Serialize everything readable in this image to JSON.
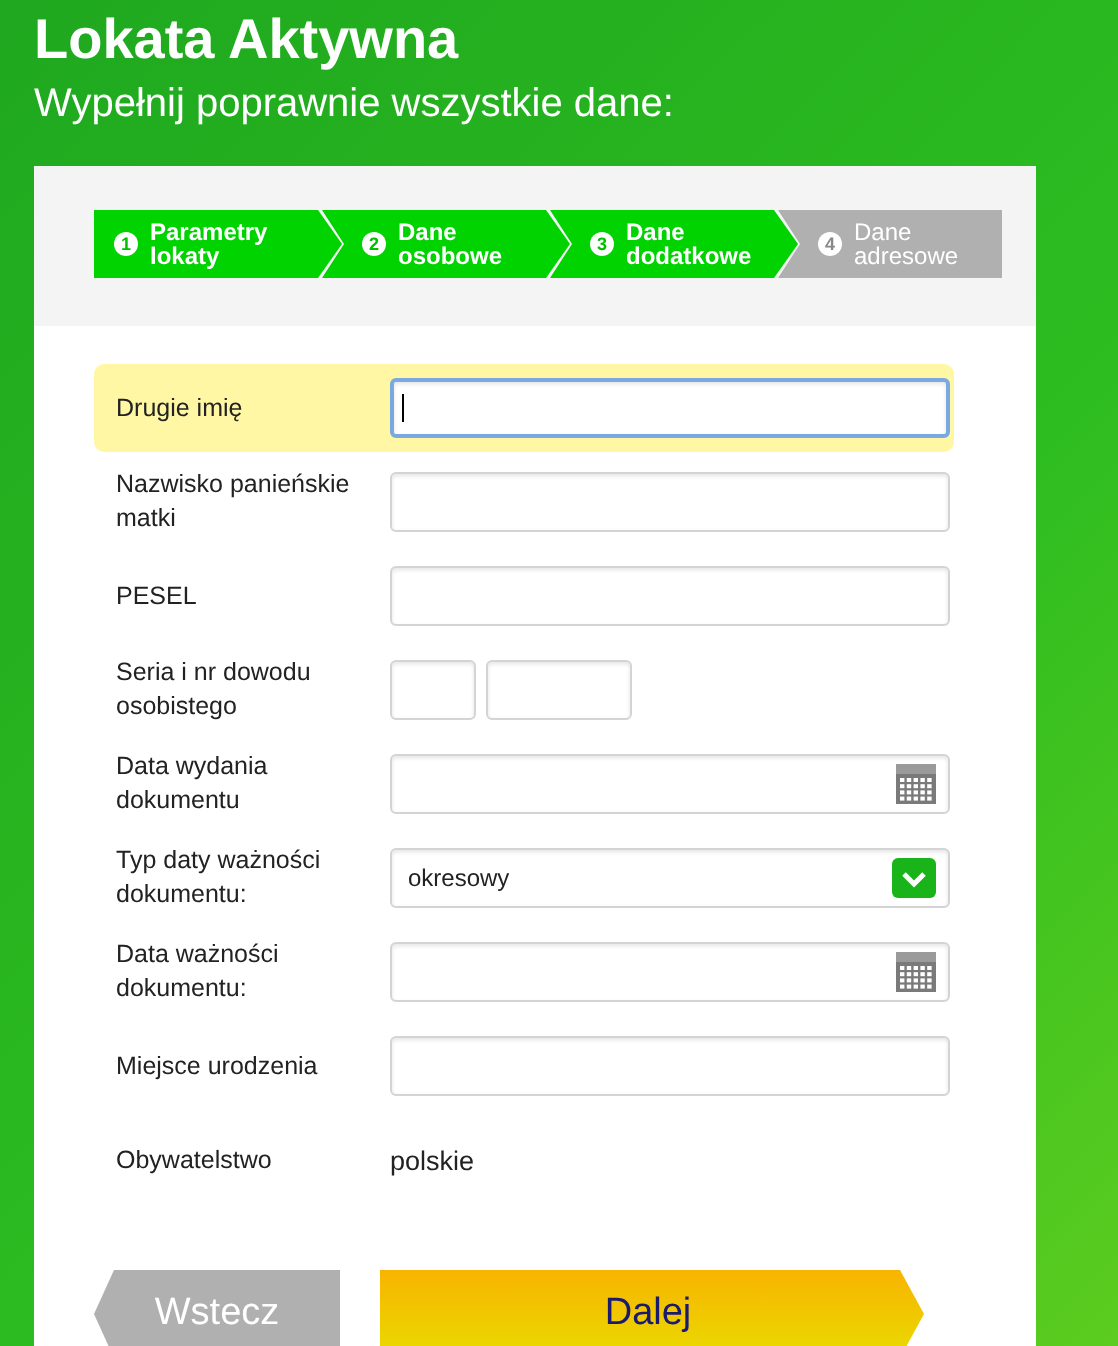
{
  "title": "Lokata Aktywna",
  "subtitle": "Wypełnij poprawnie wszystkie dane:",
  "steps": [
    {
      "number": "1",
      "label": "Parametry lokaty",
      "done": true
    },
    {
      "number": "2",
      "label": "Dane osobowe",
      "done": true
    },
    {
      "number": "3",
      "label": "Dane dodatkowe",
      "done": true
    },
    {
      "number": "4",
      "label": "Dane adresowe",
      "done": false
    }
  ],
  "fields": [
    {
      "label": "Drugie imię",
      "kind": "text",
      "focused": true
    },
    {
      "label": "Nazwisko panieńskie matki",
      "kind": "text",
      "focused": false
    },
    {
      "label": "PESEL",
      "kind": "text",
      "focused": false
    },
    {
      "label": "Seria i nr dowodu osobistego",
      "kind": "split",
      "focused": false
    },
    {
      "label": "Data wydania dokumentu",
      "kind": "date",
      "focused": false
    },
    {
      "label": "Typ daty ważności dokumentu:",
      "kind": "select",
      "value": "okresowy",
      "focused": false
    },
    {
      "label": "Data ważności dokumentu:",
      "kind": "date",
      "focused": false
    },
    {
      "label": "Miejsce urodzenia",
      "kind": "text",
      "focused": false
    },
    {
      "label": "Obywatelstwo",
      "kind": "static",
      "value": "polskie",
      "focused": false
    }
  ],
  "back_button": {
    "label": "Wstecz",
    "disabled": true
  },
  "next_button": {
    "label": "Dalej"
  }
}
